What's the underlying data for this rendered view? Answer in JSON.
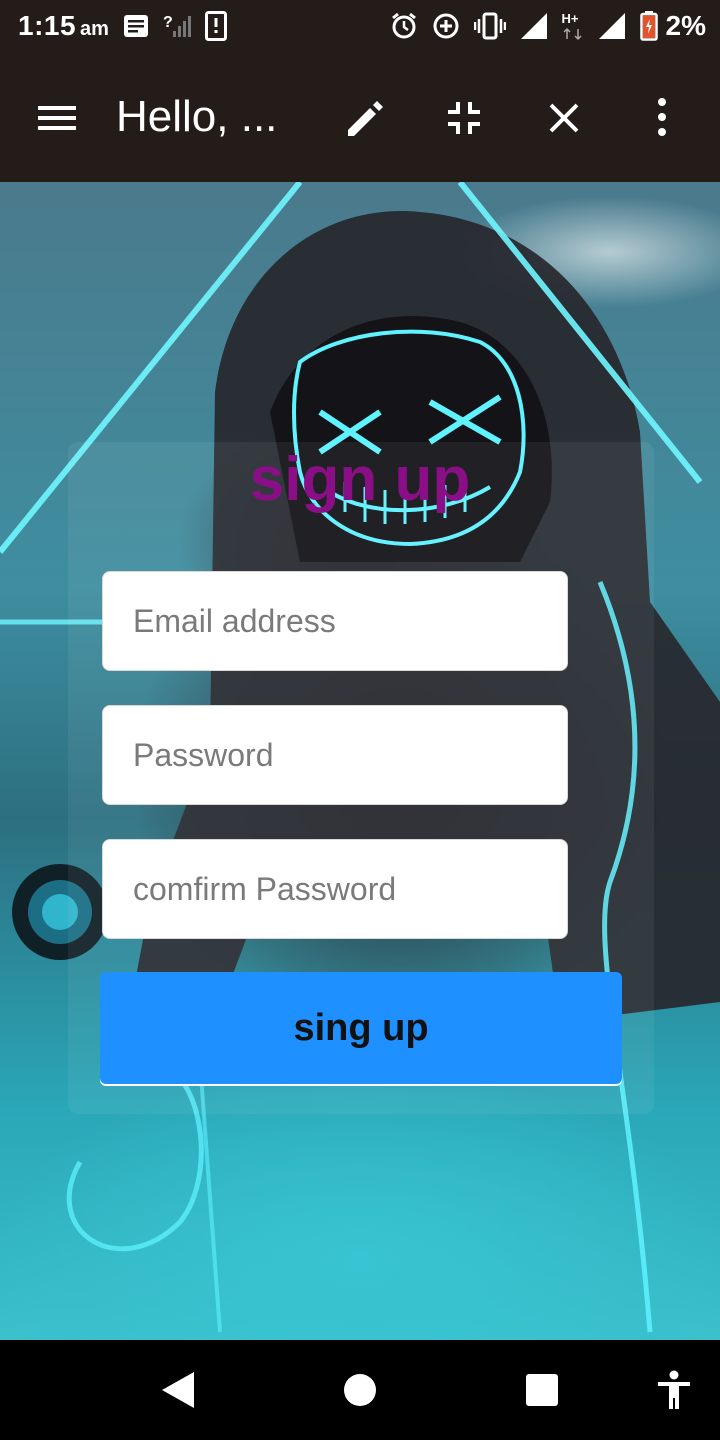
{
  "status_bar": {
    "time": "1:15",
    "ampm": "am",
    "battery": "2%",
    "network_type": "H+",
    "icons": [
      "notification-icon",
      "no-signal-sim-icon",
      "phone-icon",
      "alarm-icon",
      "data-saver-icon",
      "vibrate-icon",
      "signal-icon",
      "signal-icon",
      "battery-icon"
    ]
  },
  "app_bar": {
    "title": "Hello, ...",
    "icons": [
      "menu-icon",
      "edit-icon",
      "collapse-icon",
      "close-icon",
      "more-vert-icon"
    ]
  },
  "form": {
    "heading": "sign up",
    "email_placeholder": "Email address",
    "password_placeholder": "Password",
    "confirm_placeholder": "comfirm Password",
    "button_label": "sing up"
  },
  "nav_bar": {
    "icons": [
      "back-icon",
      "home-icon",
      "recents-icon",
      "accessibility-icon"
    ]
  },
  "colors": {
    "bar_background": "#231c19",
    "heading": "#8a0f86",
    "button": "#1e90ff",
    "neon": "#5ff2ff"
  }
}
